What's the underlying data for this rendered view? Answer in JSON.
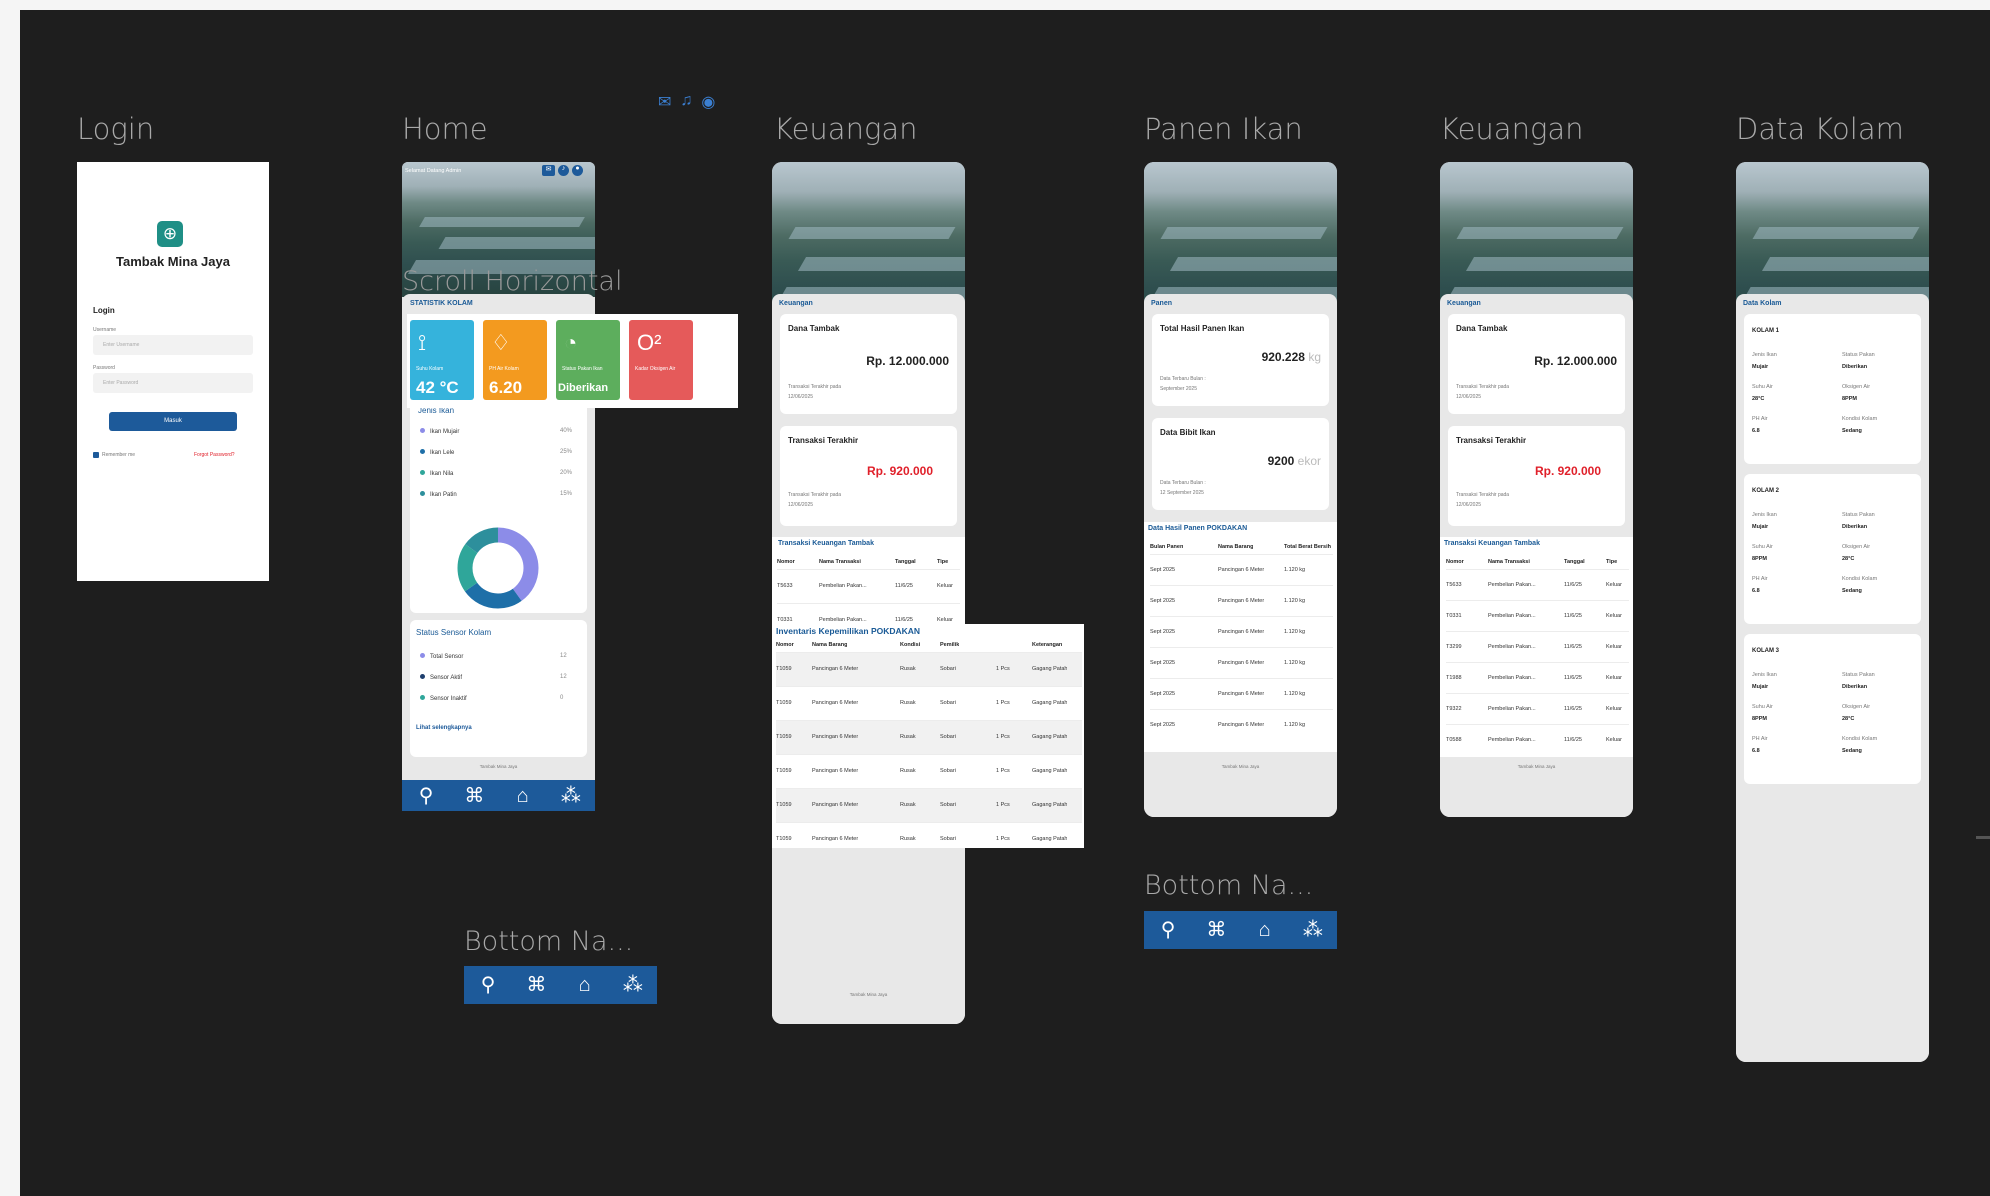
{
  "frames": {
    "login": {
      "title": "Login"
    },
    "home": {
      "title": "Home"
    },
    "keuangan1": {
      "title": "Keuangan"
    },
    "panen": {
      "title": "Panen Ikan"
    },
    "keuangan2": {
      "title": "Keuangan"
    },
    "kolam": {
      "title": "Data Kolam"
    }
  },
  "labels": {
    "scroll_horizontal": "Scroll Horizontal",
    "bottom_nav_1": "Bottom Na...",
    "bottom_nav_2": "Bottom Na..."
  },
  "login": {
    "app_name": "Tambak Mina Jaya",
    "heading": "Login",
    "username_label": "Username",
    "username_placeholder": "Enter Username",
    "password_label": "Password",
    "password_placeholder": "Enter Password",
    "submit_label": "Masuk",
    "remember_label": "Remember me",
    "forgot_label": "Forgot Password?"
  },
  "home": {
    "greeting": "Selamat Datang Admin",
    "stat_title": "STATISTIK KOLAM",
    "stats": [
      {
        "label": "Suhu Kolam",
        "value": "42 °C",
        "color": "#35b3dc",
        "icon": "thermometer-icon"
      },
      {
        "label": "PH Air Kolam",
        "value": "6.20",
        "color": "#f39a1f",
        "icon": "droplets-icon"
      },
      {
        "label": "Status Pakan Ikan",
        "value": "Diberikan",
        "color": "#5dae5d",
        "icon": "feed-icon"
      },
      {
        "label": "Kadar Oksigen Air",
        "value": "",
        "color": "#e55a5a",
        "icon": "oxygen-icon"
      }
    ],
    "jenis_title": "Jenis Ikan",
    "jenis": [
      {
        "name": "Ikan Mujair",
        "pct": "40%",
        "color": "#8c8ce8"
      },
      {
        "name": "Ikan Lele",
        "pct": "25%",
        "color": "#1e6fa8"
      },
      {
        "name": "Ikan Nila",
        "pct": "20%",
        "color": "#2fa69a"
      },
      {
        "name": "Ikan Patin",
        "pct": "15%",
        "color": "#2d8f9c"
      }
    ],
    "sensor_title": "Status Sensor Kolam",
    "sensors": [
      {
        "name": "Total Sensor",
        "value": "12",
        "color": "#8c8ce8"
      },
      {
        "name": "Sensor Aktif",
        "value": "12",
        "color": "#1e3f6e"
      },
      {
        "name": "Sensor Inaktif",
        "value": "0",
        "color": "#2fa69a"
      }
    ],
    "sensor_link": "Lihat selengkapnya",
    "footer": "Tambak Mina Jaya"
  },
  "keuangan": {
    "section": "Keuangan",
    "dana_title": "Dana Tambak",
    "dana_value": "Rp. 12.000.000",
    "dana_note": "Transaksi Terakhir pada",
    "dana_date": "12/06/2025",
    "trans_title": "Transaksi Terakhir",
    "trans_value": "Rp. 920.000",
    "trans_note": "Transaksi Terakhir pada",
    "trans_date": "12/06/2025",
    "table_title": "Transaksi Keuangan Tambak",
    "headers": [
      "Nomor",
      "Nama Transaksi",
      "Tanggal",
      "Tipe"
    ],
    "rows": [
      [
        "T5633",
        "Pembelian Pakan...",
        "11/6/25",
        "Keluar"
      ],
      [
        "T0331",
        "Pembelian Pakan...",
        "11/6/25",
        "Keluar"
      ],
      [
        "T3299",
        "Pembelian Pakan...",
        "11/6/25",
        "Keluar"
      ],
      [
        "T1988",
        "Pembelian Pakan...",
        "11/6/25",
        "Keluar"
      ],
      [
        "T9322",
        "Pembelian Pakan...",
        "11/6/25",
        "Keluar"
      ],
      [
        "T0588",
        "Pembelian Pakan...",
        "11/6/25",
        "Keluar"
      ]
    ],
    "inv_title": "Inventaris Kepemilikan POKDAKAN",
    "inv_headers": [
      "Nomor",
      "Nama Barang",
      "Kondisi",
      "Pemilik",
      "",
      "Keterangan"
    ],
    "inv_rows": [
      [
        "T1059",
        "Pancingan 6 Meter",
        "Rusak",
        "Sobari",
        "1 Pcs",
        "Gagang Patah"
      ],
      [
        "T1059",
        "Pancingan 6 Meter",
        "Rusak",
        "Sobari",
        "1 Pcs",
        "Gagang Patah"
      ],
      [
        "T1059",
        "Pancingan 6 Meter",
        "Rusak",
        "Sobari",
        "1 Pcs",
        "Gagang Patah"
      ],
      [
        "T1059",
        "Pancingan 6 Meter",
        "Rusak",
        "Sobari",
        "1 Pcs",
        "Gagang Patah"
      ],
      [
        "T1059",
        "Pancingan 6 Meter",
        "Rusak",
        "Sobari",
        "1 Pcs",
        "Gagang Patah"
      ],
      [
        "T1059",
        "Pancingan 6 Meter",
        "Rusak",
        "Sobari",
        "1 Pcs",
        "Gagang Patah"
      ]
    ],
    "footer": "Tambak Mina Jaya"
  },
  "panen": {
    "section": "Panen",
    "total_title": "Total Hasil Panen Ikan",
    "total_value": "920.228",
    "total_unit": "kg",
    "total_note": "Data Terbaru Bulan :",
    "total_date": "September 2025",
    "bibit_title": "Data Bibit Ikan",
    "bibit_value": "9200",
    "bibit_unit": "ekor",
    "bibit_note": "Data Terbaru Bulan :",
    "bibit_date": "12 September 2025",
    "table_title": "Data Hasil Panen POKDAKAN",
    "headers": [
      "Bulan Panen",
      "Nama Barang",
      "Total Berat Bersih"
    ],
    "rows": [
      [
        "Sept 2025",
        "Pancingan 6 Meter",
        "1.120 kg"
      ],
      [
        "Sept 2025",
        "Pancingan 6 Meter",
        "1.120 kg"
      ],
      [
        "Sept 2025",
        "Pancingan 6 Meter",
        "1.120 kg"
      ],
      [
        "Sept 2025",
        "Pancingan 6 Meter",
        "1.120 kg"
      ],
      [
        "Sept 2025",
        "Pancingan 6 Meter",
        "1.120 kg"
      ],
      [
        "Sept 2025",
        "Pancingan 6 Meter",
        "1.120 kg"
      ]
    ],
    "footer": "Tambak Mina Jaya"
  },
  "kolam": {
    "section": "Data Kolam",
    "cards": [
      {
        "name": "KOLAM 1",
        "k1": "Jenis Ikan",
        "v1": "Mujair",
        "k2": "Status Pakan",
        "v2": "Diberikan",
        "k3": "Suhu Air",
        "v3": "28°C",
        "k4": "Oksigen Air",
        "v4": "8PPM",
        "k5": "PH Air",
        "v5": "6.8",
        "k6": "Kondisi Kolam",
        "v6": "Sedang"
      },
      {
        "name": "KOLAM 2",
        "k1": "Jenis Ikan",
        "v1": "Mujair",
        "k2": "Status Pakan",
        "v2": "Diberikan",
        "k3": "Suhu Air",
        "v3": "8PPM",
        "k4": "Oksigen Air",
        "v4": "28°C",
        "k5": "PH Air",
        "v5": "6.8",
        "k6": "Kondisi Kolam",
        "v6": "Sedang"
      },
      {
        "name": "KOLAM 3",
        "k1": "Jenis Ikan",
        "v1": "Mujair",
        "k2": "Status Pakan",
        "v2": "Diberikan",
        "k3": "Suhu Air",
        "v3": "8PPM",
        "k4": "Oksigen Air",
        "v4": "28°C",
        "k5": "PH Air",
        "v5": "6.8",
        "k6": "Kondisi Kolam",
        "v6": "Sedang"
      }
    ]
  },
  "nav_icons": [
    "pond-icon",
    "fish-icon",
    "home-icon",
    "inventory-icon"
  ],
  "top_icons": [
    "mail-icon",
    "bell-icon",
    "user-icon"
  ],
  "colors": {
    "canvas": "#1e1e1e",
    "primary": "#1d5a9a",
    "accent_red": "#e0202a"
  }
}
